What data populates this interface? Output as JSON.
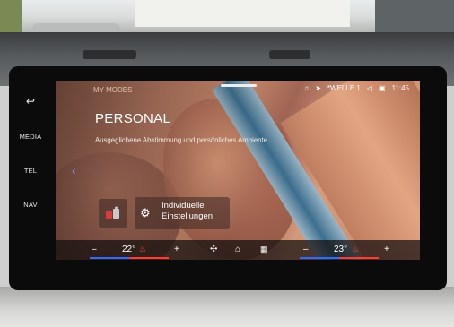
{
  "left_rail": {
    "items": [
      {
        "label": "↩",
        "name": "back-icon"
      },
      {
        "label": "MEDIA"
      },
      {
        "label": "TEL"
      },
      {
        "label": "NAV"
      }
    ]
  },
  "status": {
    "section": "MY MODES",
    "station": "WELLE 1",
    "time": "11:45"
  },
  "mode": {
    "title": "PERSONAL",
    "description": "Ausgeglichene Abstimmung und persönliches Ambiente.",
    "individual_label_line1": "Individuelle",
    "individual_label_line2": "Einstellungen"
  },
  "climate": {
    "left_minus": "–",
    "left_temp": "22°",
    "left_plus": "+",
    "right_minus": "–",
    "right_temp": "23°",
    "right_plus": "+"
  },
  "colors": {
    "accent": "#5fa2ff",
    "heat": "#ff3b32",
    "cool": "#2f6bff"
  }
}
